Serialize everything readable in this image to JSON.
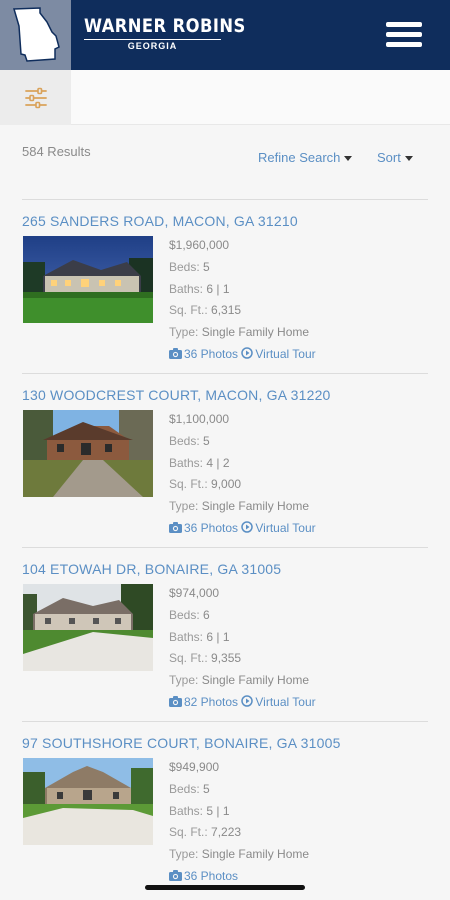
{
  "header": {
    "brand_title": "WARNER ROBINS",
    "brand_sub": "GEORGIA",
    "state_icon": "georgia-state-icon",
    "menu_icon": "hamburger-menu-icon"
  },
  "filter": {
    "icon": "sliders-icon"
  },
  "toolbar": {
    "results": "584 Results",
    "refine_label": "Refine Search",
    "sort_label": "Sort"
  },
  "listings": [
    {
      "address": "265 SANDERS ROAD, MACON, GA 31210",
      "price": "$1,960,000",
      "beds_label": "Beds:",
      "beds": "5",
      "baths_label": "Baths:",
      "baths": "6 | 1",
      "sqft_label": "Sq. Ft.:",
      "sqft": "6,315",
      "type_label": "Type:",
      "type": "Single Family Home",
      "photos": "36 Photos",
      "tour": "Virtual Tour"
    },
    {
      "address": "130 WOODCREST COURT, MACON, GA 31220",
      "price": "$1,100,000",
      "beds_label": "Beds:",
      "beds": "5",
      "baths_label": "Baths:",
      "baths": "4 | 2",
      "sqft_label": "Sq. Ft.:",
      "sqft": "9,000",
      "type_label": "Type:",
      "type": "Single Family Home",
      "photos": "36 Photos",
      "tour": "Virtual Tour"
    },
    {
      "address": "104 ETOWAH DR, BONAIRE, GA 31005",
      "price": "$974,000",
      "beds_label": "Beds:",
      "beds": "6",
      "baths_label": "Baths:",
      "baths": "6 | 1",
      "sqft_label": "Sq. Ft.:",
      "sqft": "9,355",
      "type_label": "Type:",
      "type": "Single Family Home",
      "photos": "82 Photos",
      "tour": "Virtual Tour"
    },
    {
      "address": "97 SOUTHSHORE COURT, BONAIRE, GA 31005",
      "price": "$949,900",
      "beds_label": "Beds:",
      "beds": "5",
      "baths_label": "Baths:",
      "baths": "5 | 1",
      "sqft_label": "Sq. Ft.:",
      "sqft": "7,223",
      "type_label": "Type:",
      "type": "Single Family Home",
      "photos": "36 Photos",
      "tour": ""
    }
  ],
  "colors": {
    "header_bg": "#0f2d5c",
    "state_box_bg": "#7d8ba3",
    "link": "#5b8fc4",
    "filter_icon": "#d9a25a"
  }
}
